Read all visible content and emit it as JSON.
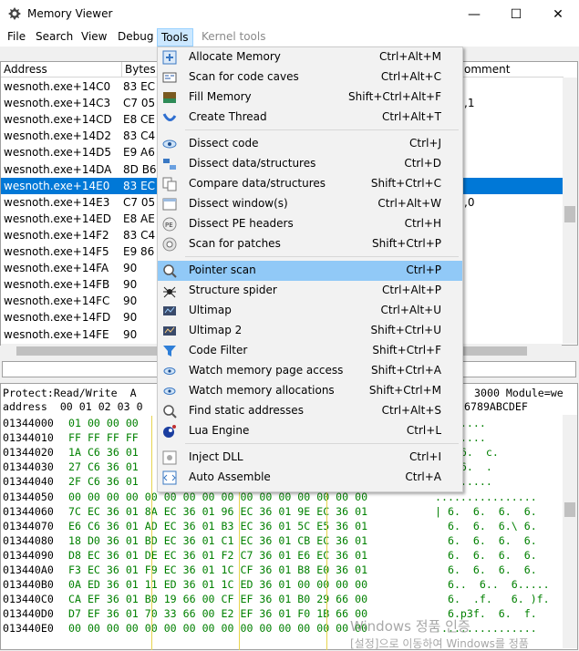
{
  "window": {
    "title": "Memory Viewer",
    "minimize": "—",
    "maximize": "☐",
    "close": "✕"
  },
  "menubar": {
    "items": [
      "File",
      "Search",
      "View",
      "Debug",
      "Tools",
      "Kernel tools"
    ]
  },
  "disasm": {
    "headers": {
      "address": "Address",
      "bytes": "Bytes",
      "comment": "omment"
    },
    "rows": [
      {
        "address": "wesnoth.exe+14C0",
        "bytes": "83 EC",
        "comment": ""
      },
      {
        "address": "wesnoth.exe+14C3",
        "bytes": "C7 05",
        "comment": ",1"
      },
      {
        "address": "wesnoth.exe+14CD",
        "bytes": "E8 CE",
        "comment": ""
      },
      {
        "address": "wesnoth.exe+14D2",
        "bytes": "83 C4",
        "comment": ""
      },
      {
        "address": "wesnoth.exe+14D5",
        "bytes": "E9 A6",
        "comment": ""
      },
      {
        "address": "wesnoth.exe+14DA",
        "bytes": "8D B6",
        "comment": ""
      },
      {
        "address": "wesnoth.exe+14E0",
        "bytes": "83 EC",
        "comment": ""
      },
      {
        "address": "wesnoth.exe+14E3",
        "bytes": "C7 05",
        "comment": ",0"
      },
      {
        "address": "wesnoth.exe+14ED",
        "bytes": "E8 AE",
        "comment": ""
      },
      {
        "address": "wesnoth.exe+14F2",
        "bytes": "83 C4",
        "comment": ""
      },
      {
        "address": "wesnoth.exe+14F5",
        "bytes": "E9 86",
        "comment": ""
      },
      {
        "address": "wesnoth.exe+14FA",
        "bytes": "90",
        "comment": ""
      },
      {
        "address": "wesnoth.exe+14FB",
        "bytes": "90",
        "comment": ""
      },
      {
        "address": "wesnoth.exe+14FC",
        "bytes": "90",
        "comment": ""
      },
      {
        "address": "wesnoth.exe+14FD",
        "bytes": "90",
        "comment": ""
      },
      {
        "address": "wesnoth.exe+14FE",
        "bytes": "90",
        "comment": ""
      }
    ],
    "selected_index": 6
  },
  "hexview": {
    "info_left": "Protect:Read/Write  A",
    "info_right": "3000 Module=we",
    "header_left": "address  00 01 02 03 0",
    "header_right": "6789ABCDEF",
    "rows": [
      {
        "addr": "01344000",
        "hex": "01 00 00 00",
        "ascii": "........"
      },
      {
        "addr": "01344010",
        "hex": "FF FF FF FF",
        "ascii": "........"
      },
      {
        "addr": "01344020",
        "hex": "1A C6 36 01",
        "ascii": "d.. 6.  c."
      },
      {
        "addr": "01344030",
        "hex": "27 C6 36 01",
        "ascii": "e.+ 6.  ."
      },
      {
        "addr": "01344040",
        "hex": "2F C6 36 01",
        "ascii": "c........"
      },
      {
        "addr": "01344050",
        "hex": "00 00 00 00 00 00 00 00 00 00 00 00 00 00 00 00",
        "ascii": "................"
      },
      {
        "addr": "01344060",
        "hex": "7C EC 36 01 8A EC 36 01 96 EC 36 01 9E EC 36 01",
        "ascii": "| 6.  6.  6.  6."
      },
      {
        "addr": "01344070",
        "hex": "E6 C6 36 01 AD EC 36 01 B3 EC 36 01 5C E5 36 01",
        "ascii": "  6.  6.  6.\\ 6."
      },
      {
        "addr": "01344080",
        "hex": "18 D0 36 01 BD EC 36 01 C1 EC 36 01 CB EC 36 01",
        "ascii": "  6.  6.  6.  6."
      },
      {
        "addr": "01344090",
        "hex": "D8 EC 36 01 DE EC 36 01 F2 C7 36 01 E6 EC 36 01",
        "ascii": "  6.  6.  6.  6."
      },
      {
        "addr": "013440A0",
        "hex": "F3 EC 36 01 F9 EC 36 01 1C CF 36 01 B8 E0 36 01",
        "ascii": "  6.  6.  6.  6."
      },
      {
        "addr": "013440B0",
        "hex": "0A ED 36 01 11 ED 36 01 1C ED 36 01 00 00 00 00",
        "ascii": "  6..  6..  6....."
      },
      {
        "addr": "013440C0",
        "hex": "CA EF 36 01 B0 19 66 00 CF EF 36 01 B0 29 66 00",
        "ascii": "  6.  .f.   6. )f."
      },
      {
        "addr": "013440D0",
        "hex": "D7 EF 36 01 70 33 66 00 E2 EF 36 01 F0 1B 66 00",
        "ascii": "  6.p3f.  6.  f."
      },
      {
        "addr": "013440E0",
        "hex": "00 00 00 00 00 00 00 00 00 00 00 00 00 00 00 00",
        "ascii": "................"
      }
    ]
  },
  "watermark": {
    "line1": "Windows 정품 인증",
    "line2": "[설정]으로 이동하여 Windows를 정품"
  },
  "tools_menu": [
    {
      "label": "Allocate Memory",
      "shortcut": "Ctrl+Alt+M",
      "icon": "plus-icon"
    },
    {
      "label": "Scan for code caves",
      "shortcut": "Ctrl+Alt+C",
      "icon": "code-cave-icon"
    },
    {
      "label": "Fill Memory",
      "shortcut": "Shift+Ctrl+Alt+F",
      "icon": "fill-icon"
    },
    {
      "label": "Create Thread",
      "shortcut": "Ctrl+Alt+T",
      "icon": "thread-icon"
    },
    {
      "label": "Dissect code",
      "shortcut": "Ctrl+J",
      "icon": "eye-icon"
    },
    {
      "label": "Dissect data/structures",
      "shortcut": "Ctrl+D",
      "icon": "structure-icon"
    },
    {
      "label": "Compare data/structures",
      "shortcut": "Shift+Ctrl+C",
      "icon": "compare-icon"
    },
    {
      "label": "Dissect window(s)",
      "shortcut": "Ctrl+Alt+W",
      "icon": "window-icon"
    },
    {
      "label": "Dissect PE headers",
      "shortcut": "Ctrl+H",
      "icon": "pe-icon"
    },
    {
      "label": "Scan for patches",
      "shortcut": "Shift+Ctrl+P",
      "icon": "patch-icon"
    },
    {
      "label": "Pointer scan",
      "shortcut": "Ctrl+P",
      "icon": "magnifier-icon"
    },
    {
      "label": "Structure spider",
      "shortcut": "Ctrl+Alt+P",
      "icon": "spider-icon"
    },
    {
      "label": "Ultimap",
      "shortcut": "Ctrl+Alt+U",
      "icon": "ultimap-icon"
    },
    {
      "label": "Ultimap 2",
      "shortcut": "Shift+Ctrl+U",
      "icon": "ultimap2-icon"
    },
    {
      "label": "Code Filter",
      "shortcut": "Shift+Ctrl+F",
      "icon": "filter-icon"
    },
    {
      "label": "Watch memory page access",
      "shortcut": "Shift+Ctrl+A",
      "icon": "watch-icon"
    },
    {
      "label": "Watch memory allocations",
      "shortcut": "Shift+Ctrl+M",
      "icon": "watch-alloc-icon"
    },
    {
      "label": "Find static addresses",
      "shortcut": "Ctrl+Alt+S",
      "icon": "search-icon"
    },
    {
      "label": "Lua Engine",
      "shortcut": "Ctrl+L",
      "icon": "lua-icon"
    },
    {
      "label": "Inject DLL",
      "shortcut": "Ctrl+I",
      "icon": "dll-icon"
    },
    {
      "label": "Auto Assemble",
      "shortcut": "Ctrl+A",
      "icon": "assemble-icon"
    }
  ],
  "tools_menu_highlighted": "Pointer scan",
  "colors": {
    "accent": "#0078d7",
    "menu_highlight": "#91c9f7",
    "hex_text": "#008000"
  }
}
